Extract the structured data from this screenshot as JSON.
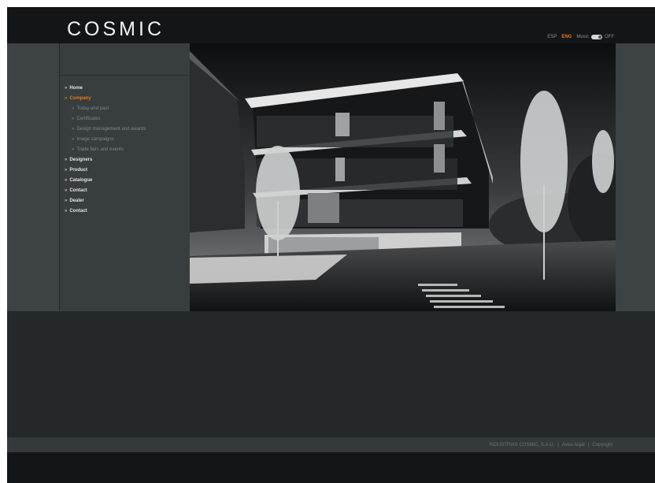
{
  "header": {
    "logo": "COSMIC",
    "languages": [
      "ESP",
      "ENG"
    ],
    "active_language": "ENG",
    "music_label": "Music",
    "music_on": "ON",
    "music_off": "OFF"
  },
  "nav": {
    "items": [
      {
        "label": "Home",
        "level": 1,
        "active": false
      },
      {
        "label": "Company",
        "level": 1,
        "active": true
      },
      {
        "label": "Today and past",
        "level": 2,
        "active": false
      },
      {
        "label": "Certificates",
        "level": 2,
        "active": false
      },
      {
        "label": "Design management and awards",
        "level": 2,
        "active": false
      },
      {
        "label": "Image campaigns",
        "level": 2,
        "active": false
      },
      {
        "label": "Trade fairs and events",
        "level": 2,
        "active": false
      },
      {
        "label": "Designers",
        "level": 1,
        "active": false
      },
      {
        "label": "Product",
        "level": 1,
        "active": false
      },
      {
        "label": "Catalogue",
        "level": 1,
        "active": false
      },
      {
        "label": "Contact",
        "level": 1,
        "active": false
      },
      {
        "label": "Dealer",
        "level": 1,
        "active": false
      },
      {
        "label": "Contact",
        "level": 1,
        "active": false
      }
    ]
  },
  "footer": {
    "company": "INDUSTRIAS COSMIC, S.A.U.",
    "separator": "|",
    "legal": "Aviso legal",
    "copyright": "Copyright"
  },
  "colors": {
    "accent": "#e07c1d",
    "top_bar": "#141516",
    "panel": "#3d4244"
  }
}
